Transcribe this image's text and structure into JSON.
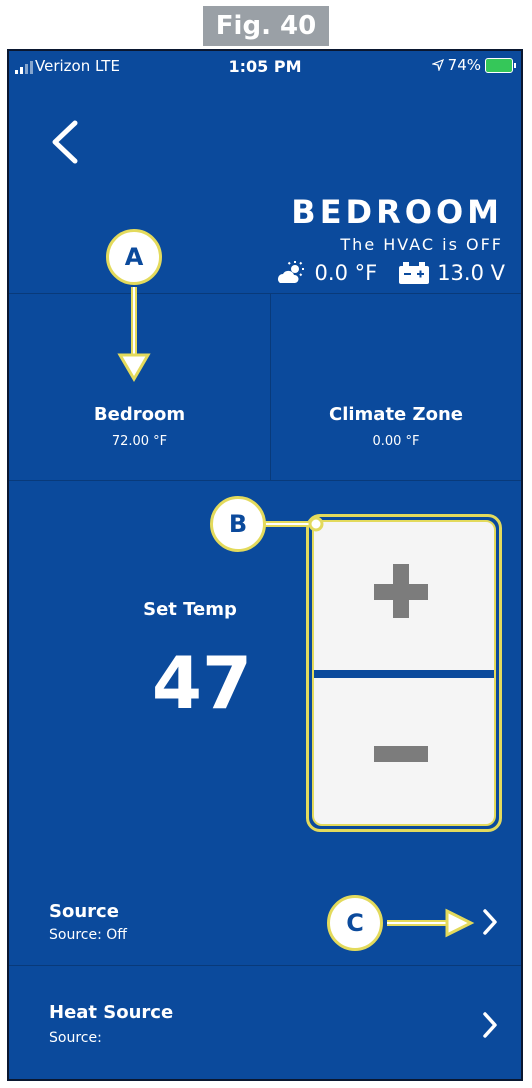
{
  "figure_label": "Fig. 40",
  "status_bar": {
    "carrier": "Verizon  LTE",
    "time": "1:05 PM",
    "battery": "74%"
  },
  "header": {
    "title": "BEDROOM",
    "hvac_status": "The HVAC is OFF",
    "outdoor_temp": "0.0 °F",
    "voltage": "13.0 V"
  },
  "zones": [
    {
      "name": "Bedroom",
      "temp": "72.00 °F"
    },
    {
      "name": "Climate Zone",
      "temp": "0.00 °F"
    }
  ],
  "set_temp": {
    "label": "Set Temp",
    "value": "47"
  },
  "rows": [
    {
      "title": "Source",
      "subtitle": "Source: Off"
    },
    {
      "title": "Heat Source",
      "subtitle": "Source:"
    }
  ],
  "callouts": {
    "a": "A",
    "b": "B",
    "c": "C"
  },
  "colors": {
    "background": "#0b4a9c",
    "callout_outline": "#e3da5c",
    "stepper_bg": "#f5f5f5",
    "stepper_icon": "#7c7c7c"
  }
}
